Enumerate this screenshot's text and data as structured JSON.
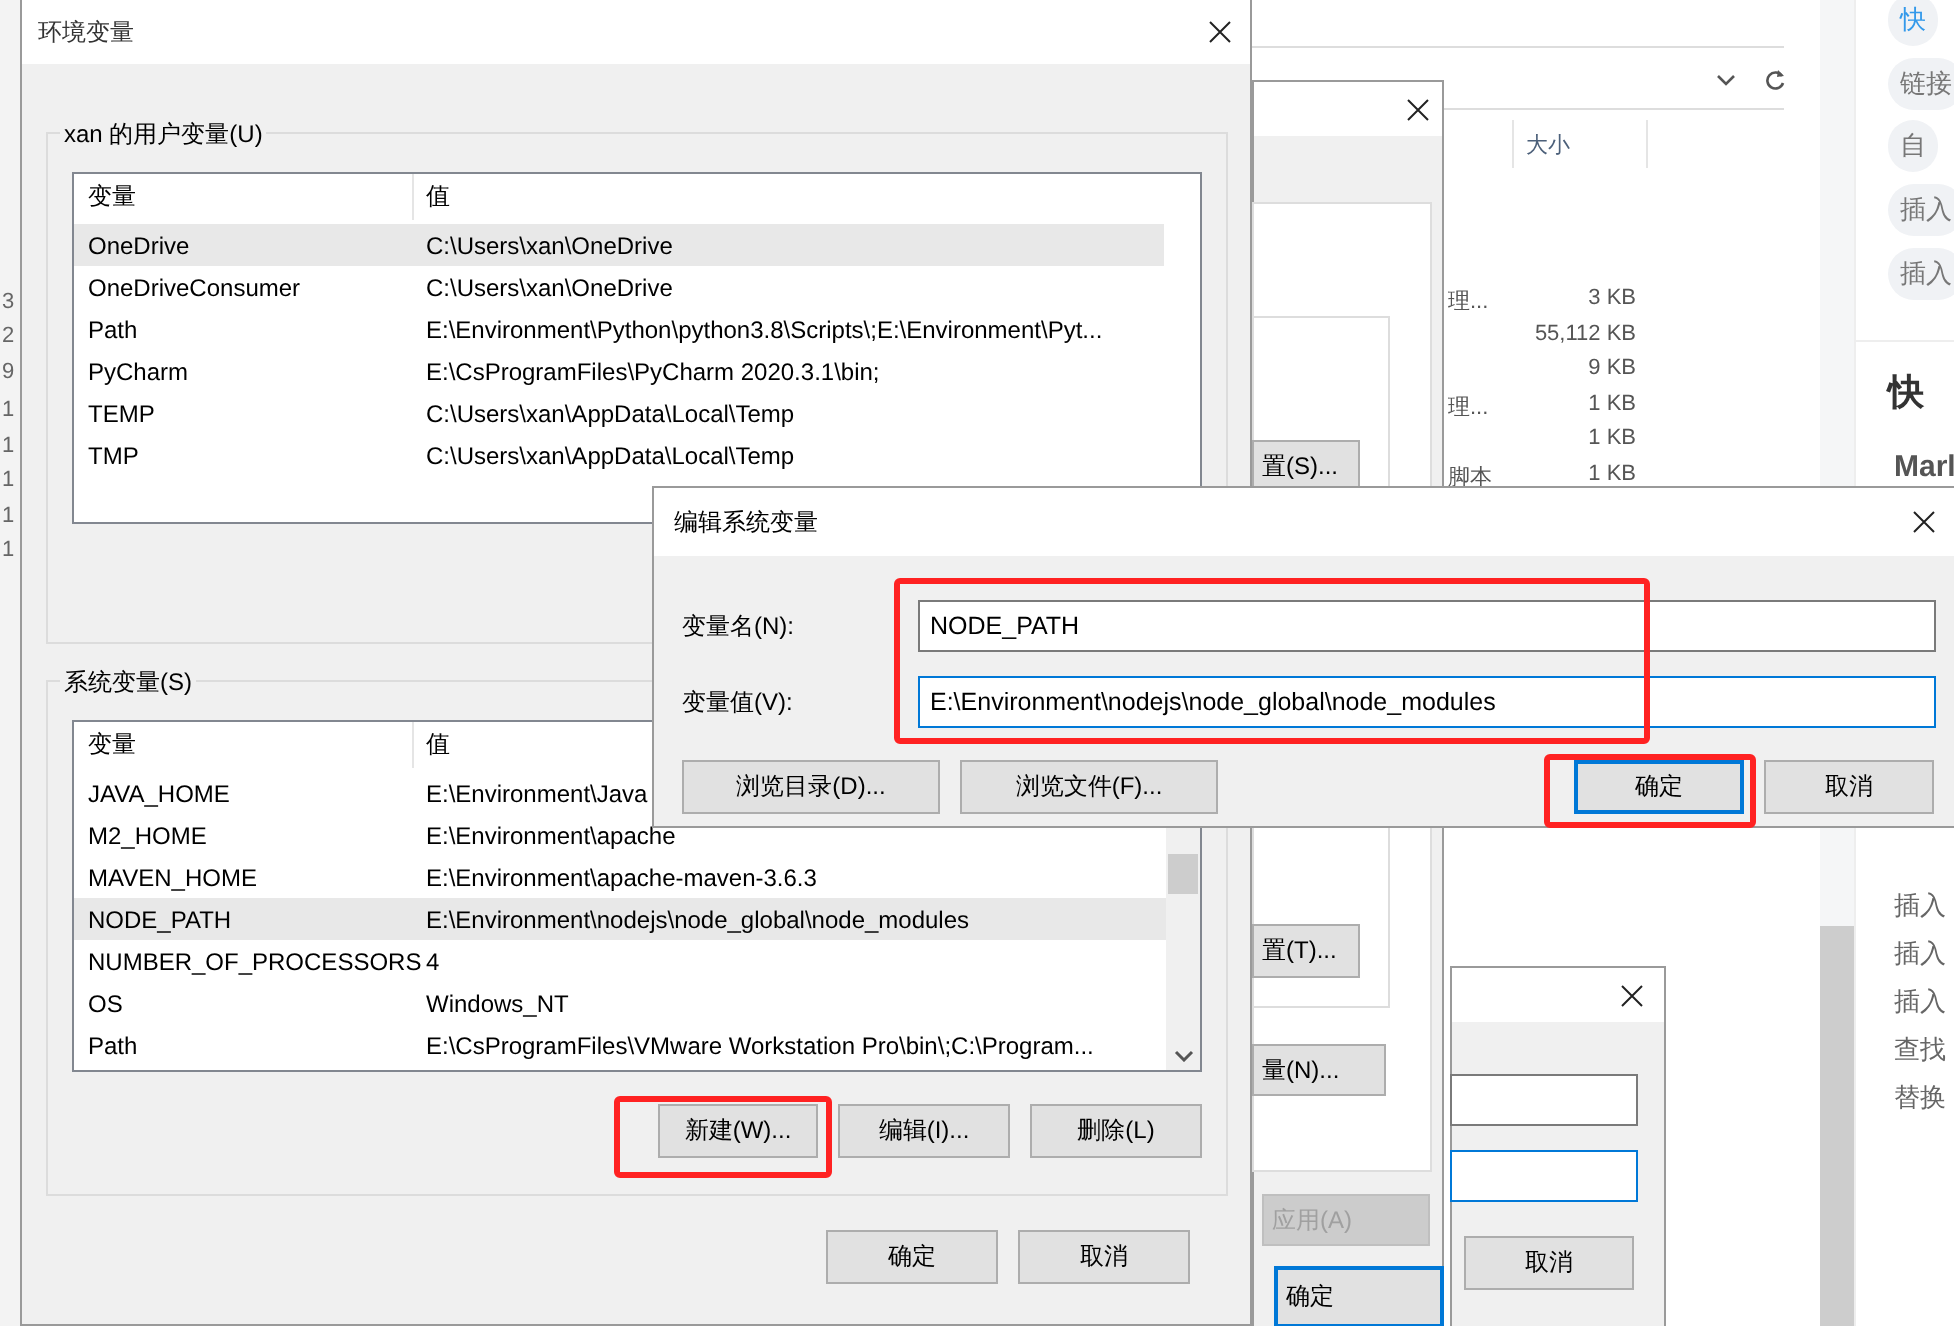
{
  "explorer": {
    "left_digits": [
      "3",
      "2",
      "9",
      "1",
      "1",
      "1",
      "1",
      "1"
    ],
    "size_header": "大小",
    "rows": [
      {
        "type": "理...",
        "size": "3 KB"
      },
      {
        "type": "",
        "size": "55,112 KB"
      },
      {
        "type": "",
        "size": "9 KB"
      },
      {
        "type": "理...",
        "size": "1 KB"
      },
      {
        "type": "",
        "size": "1 KB"
      },
      {
        "type": "脚本",
        "size": "1 KB"
      }
    ]
  },
  "sidebar": {
    "chips": [
      {
        "label": "快",
        "selected": true
      },
      {
        "label": "链接",
        "selected": false
      },
      {
        "label": "自",
        "selected": false
      },
      {
        "label": "插入",
        "selected": false
      },
      {
        "label": "插入",
        "selected": false
      }
    ],
    "heading": "快",
    "subheading": "Marl",
    "items": [
      "插入",
      "插入",
      "插入",
      "查找",
      "替换"
    ]
  },
  "system_properties_window": {
    "buttons": [
      {
        "label": "置(S)...",
        "disabled": false,
        "default": false
      },
      {
        "label": "置(T)...",
        "disabled": false,
        "default": false
      },
      {
        "label": "量(N)...",
        "disabled": false,
        "default": false
      },
      {
        "label": "应用(A)",
        "disabled": true,
        "default": false
      },
      {
        "label": "确定",
        "disabled": false,
        "default": true
      }
    ]
  },
  "small_dialog": {
    "fields": [
      {
        "focused": false
      },
      {
        "focused": true
      }
    ],
    "buttons": [
      "取消"
    ]
  },
  "environment_window": {
    "title": "环境变量",
    "user_group": {
      "label": "xan 的用户变量(U)",
      "columns": [
        "变量",
        "值"
      ],
      "rows": [
        {
          "name": "OneDrive",
          "value": "C:\\Users\\xan\\OneDrive",
          "selected": true
        },
        {
          "name": "OneDriveConsumer",
          "value": "C:\\Users\\xan\\OneDrive",
          "selected": false
        },
        {
          "name": "Path",
          "value": "E:\\Environment\\Python\\python3.8\\Scripts\\;E:\\Environment\\Pyt...",
          "selected": false
        },
        {
          "name": "PyCharm",
          "value": "E:\\CsProgramFiles\\PyCharm 2020.3.1\\bin;",
          "selected": false
        },
        {
          "name": "TEMP",
          "value": "C:\\Users\\xan\\AppData\\Local\\Temp",
          "selected": false
        },
        {
          "name": "TMP",
          "value": "C:\\Users\\xan\\AppData\\Local\\Temp",
          "selected": false
        }
      ]
    },
    "system_group": {
      "label": "系统变量(S)",
      "columns": [
        "变量",
        "值"
      ],
      "rows": [
        {
          "name": "JAVA_HOME",
          "value": "E:\\Environment\\Java",
          "selected": false
        },
        {
          "name": "M2_HOME",
          "value": "E:\\Environment\\apache",
          "selected": false
        },
        {
          "name": "MAVEN_HOME",
          "value": "E:\\Environment\\apache-maven-3.6.3",
          "selected": false
        },
        {
          "name": "NODE_PATH",
          "value": "E:\\Environment\\nodejs\\node_global\\node_modules",
          "selected": true
        },
        {
          "name": "NUMBER_OF_PROCESSORS",
          "value": "4",
          "selected": false
        },
        {
          "name": "OS",
          "value": "Windows_NT",
          "selected": false
        },
        {
          "name": "Path",
          "value": "E:\\CsProgramFiles\\VMware Workstation Pro\\bin\\;C:\\Program...",
          "selected": false
        }
      ],
      "buttons": [
        {
          "label": "新建(W)...",
          "highlighted": true
        },
        {
          "label": "编辑(I)...",
          "highlighted": false
        },
        {
          "label": "删除(L)",
          "highlighted": false
        }
      ]
    },
    "buttons": [
      "确定",
      "取消"
    ]
  },
  "edit_dialog": {
    "title": "编辑系统变量",
    "fields": [
      {
        "label": "变量名(N):",
        "value": "NODE_PATH",
        "focused": false
      },
      {
        "label": "变量值(V):",
        "value": "E:\\Environment\\nodejs\\node_global\\node_modules",
        "focused": true
      }
    ],
    "buttons": [
      {
        "label": "浏览目录(D)...",
        "default": false,
        "highlighted": false
      },
      {
        "label": "浏览文件(F)...",
        "default": false,
        "highlighted": false
      },
      {
        "label": "确定",
        "default": true,
        "highlighted": true
      },
      {
        "label": "取消",
        "default": false,
        "highlighted": false
      }
    ]
  }
}
